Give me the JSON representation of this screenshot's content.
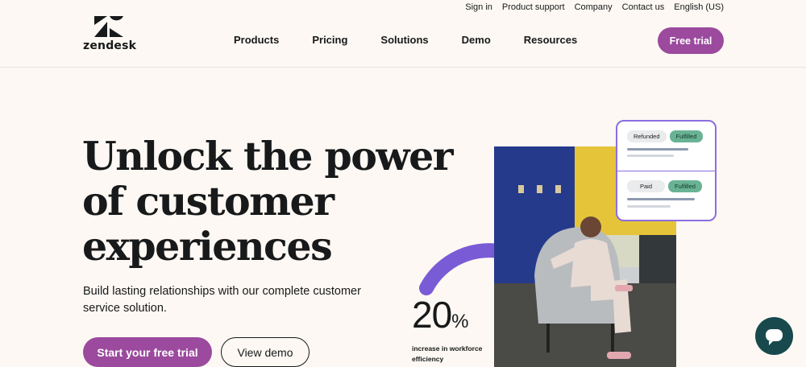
{
  "brand": {
    "name": "zendesk",
    "accent": "#9b4a9e"
  },
  "utility_nav": [
    "Sign in",
    "Product support",
    "Company",
    "Contact us",
    "English (US)"
  ],
  "main_nav": [
    "Products",
    "Pricing",
    "Solutions",
    "Demo",
    "Resources"
  ],
  "header": {
    "cta_label": "Free trial"
  },
  "hero": {
    "headline_lines": [
      "Unlock the power",
      "of customer",
      "experiences"
    ],
    "subtext": "Build lasting relationships with our complete customer service solution.",
    "primary_cta": "Start your free trial",
    "secondary_cta": "View demo"
  },
  "stat": {
    "number": "20",
    "suffix": "%",
    "label": "increase in workforce efficiency"
  },
  "order_card": {
    "row1": {
      "status": "Refunded",
      "badge": "Fulfilled"
    },
    "row2": {
      "status": "Paid",
      "badge": "Fulfilled"
    }
  },
  "chat": {
    "icon": "chat-bubble-icon"
  }
}
